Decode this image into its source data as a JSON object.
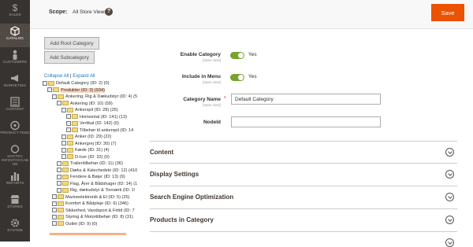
{
  "sidebar": {
    "items": [
      {
        "label": "SALES",
        "icon": "dollar-icon",
        "active": false
      },
      {
        "label": "CATALOG",
        "icon": "cube-icon",
        "active": true
      },
      {
        "label": "CUSTOMERS",
        "icon": "person-icon",
        "active": false
      },
      {
        "label": "MARKETING",
        "icon": "megaphone-icon",
        "active": false
      },
      {
        "label": "CONTENT",
        "icon": "content-grid-icon",
        "active": false
      },
      {
        "label": "PRODUCT FEED",
        "icon": "feed-icon",
        "active": false
      },
      {
        "label": "SOCTEC INFOSTOCCAB ON",
        "icon": "soctec-icon",
        "active": false
      },
      {
        "label": "REPORTS",
        "icon": "bar-chart-icon",
        "active": false
      },
      {
        "label": "STORES",
        "icon": "store-icon",
        "active": false
      },
      {
        "label": "SYSTEM",
        "icon": "gear-icon",
        "active": false
      }
    ]
  },
  "header": {
    "scope_label": "Scope:",
    "scope_value": "All Store Views",
    "help_symbol": "?",
    "save_label": "Save"
  },
  "buttons": {
    "add_root": "Add Root Category",
    "add_sub": "Add Subcategory"
  },
  "tree": {
    "collapse_all": "Collapse All",
    "separator": "|",
    "expand_all": "Expand All",
    "rows": [
      {
        "text": "Default Category (ID: 2) (0)",
        "level": 0,
        "selected": false
      },
      {
        "text": "Produkter (ID: 3) (934)",
        "level": 1,
        "selected": true
      },
      {
        "text": "Ankering, Rig & Dækudstyr (ID: 4) (5",
        "level": 2,
        "selected": false
      },
      {
        "text": "Ankering (ID: 10) (59)",
        "level": 3,
        "selected": false
      },
      {
        "text": "Ankerspil (ID: 28) (26)",
        "level": 4,
        "selected": false
      },
      {
        "text": "Horisontal (ID: 141) (13)",
        "level": 5,
        "selected": false
      },
      {
        "text": "Vertikal (ID: 142) (0)",
        "level": 5,
        "selected": false
      },
      {
        "text": "Tilbehør til ankerspil (ID: 14",
        "level": 5,
        "selected": false
      },
      {
        "text": "Anker (ID: 29) (22)",
        "level": 4,
        "selected": false
      },
      {
        "text": "Ankergrej (ID: 30) (7)",
        "level": 4,
        "selected": false
      },
      {
        "text": "Kæde (ID: 31) (4)",
        "level": 4,
        "selected": false
      },
      {
        "text": "D-Icer (ID: 32) (0)",
        "level": 4,
        "selected": false
      },
      {
        "text": "Traileritilbehør (ID: 11) (36)",
        "level": 3,
        "selected": false
      },
      {
        "text": "Dæks & Kalechedele (ID: 12) (410",
        "level": 3,
        "selected": false
      },
      {
        "text": "Fendere & Bøjer (ID: 13) (9)",
        "level": 3,
        "selected": false
      },
      {
        "text": "Flag, Årer & Bådshager (ID: 14) (1",
        "level": 3,
        "selected": false
      },
      {
        "text": "Rig, dækudstyr & Tovværk (ID: 1!",
        "level": 3,
        "selected": false
      },
      {
        "text": "Marineelektronik & El (ID: 5) (25)",
        "level": 2,
        "selected": false
      },
      {
        "text": "Komfort & Bådpleje (ID: 6) (346)",
        "level": 2,
        "selected": false
      },
      {
        "text": "Sikkerhed, Vandsport & Fritid (ID: 7",
        "level": 2,
        "selected": false
      },
      {
        "text": "Styring & Motortilbehør (ID: 8) (31)",
        "level": 2,
        "selected": false
      },
      {
        "text": "Outlet (ID: 9) (0)",
        "level": 2,
        "selected": false
      }
    ]
  },
  "form": {
    "enable_category_label": "Enable Category",
    "enable_category_scope": "[store view]",
    "enable_category_value": "Yes",
    "include_menu_label": "Include in Menu",
    "include_menu_scope": "[store view]",
    "include_menu_value": "Yes",
    "category_name_label": "Category Name",
    "category_name_scope": "[store view]",
    "category_name_value": "Default Category",
    "required_mark": "*",
    "nodeid_label": "NodeId",
    "nodeid_value": ""
  },
  "sections": [
    {
      "title": "Content"
    },
    {
      "title": "Display Settings"
    },
    {
      "title": "Search Engine Optimization"
    },
    {
      "title": "Products in Category"
    }
  ],
  "colors": {
    "sidebar_bg": "#373330",
    "accent_orange": "#eb5202",
    "toggle_green": "#79a22e",
    "link_blue": "#1979c3"
  }
}
